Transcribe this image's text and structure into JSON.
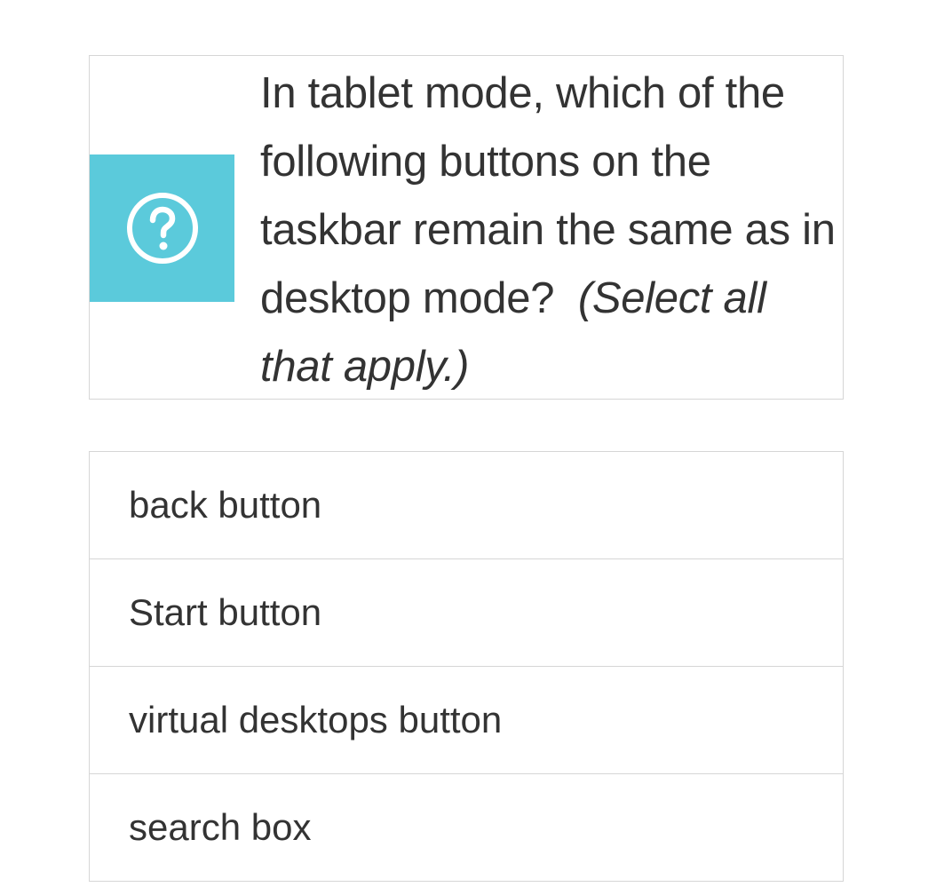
{
  "question": {
    "text": "In tablet mode, which of the following buttons on the taskbar remain the same as in desktop mode?",
    "hint": "(Select all that apply.)",
    "icon": "question-circle-icon",
    "icon_bg_color": "#5bcadb"
  },
  "options": [
    {
      "label": "back button"
    },
    {
      "label": "Start button"
    },
    {
      "label": "virtual desktops button"
    },
    {
      "label": "search box"
    }
  ]
}
